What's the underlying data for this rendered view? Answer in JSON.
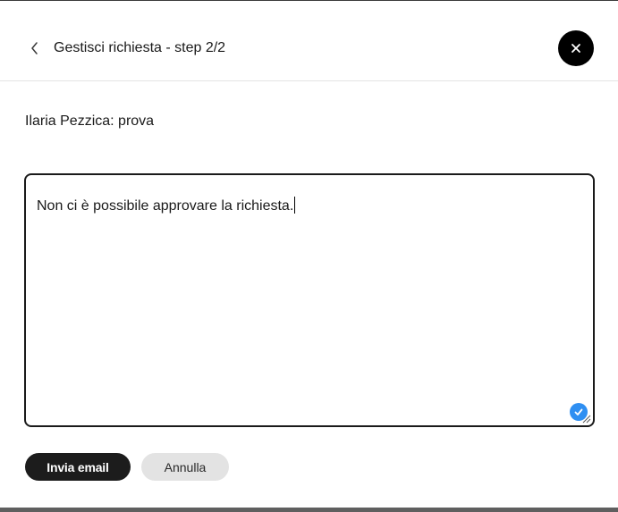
{
  "header": {
    "title": "Gestisci richiesta - step 2/2",
    "back_icon": "chevron-left-icon",
    "close_icon": "close-icon"
  },
  "request": {
    "summary": "Ilaria Pezzica: prova"
  },
  "message": {
    "value": "Non ci è possibile approvare la richiesta."
  },
  "actions": {
    "send_label": "Invia email",
    "cancel_label": "Annulla"
  },
  "colors": {
    "primary": "#1c1c1c",
    "secondary": "#e3e3e3",
    "check_badge": "#2f8ff2"
  }
}
